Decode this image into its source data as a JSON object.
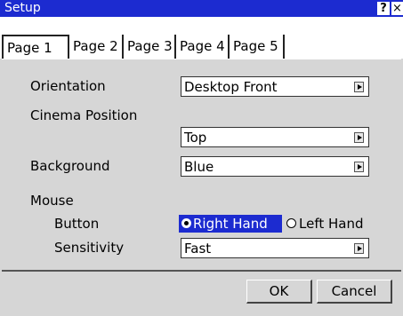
{
  "window": {
    "title": "Setup",
    "help_label": "?",
    "close_label": "×"
  },
  "tabs": [
    {
      "label": "Page 1",
      "active": true
    },
    {
      "label": "Page 2",
      "active": false
    },
    {
      "label": "Page 3",
      "active": false
    },
    {
      "label": "Page 4",
      "active": false
    },
    {
      "label": "Page 5",
      "active": false
    }
  ],
  "settings": {
    "orientation": {
      "label": "Orientation",
      "value": "Desktop Front"
    },
    "cinema_position": {
      "label": "Cinema Position",
      "value": "Top"
    },
    "background": {
      "label": "Background",
      "value": "Blue"
    },
    "mouse": {
      "label": "Mouse",
      "button": {
        "label": "Button",
        "right_hand": "Right Hand",
        "left_hand": "Left Hand",
        "selected": "Right Hand"
      },
      "sensitivity": {
        "label": "Sensitivity",
        "value": "Fast"
      }
    }
  },
  "footer": {
    "ok_label": "OK",
    "cancel_label": "Cancel"
  },
  "colors": {
    "titlebar": "#1c2bd0",
    "panel": "#d6d6d6",
    "selection": "#1c2bd0"
  }
}
